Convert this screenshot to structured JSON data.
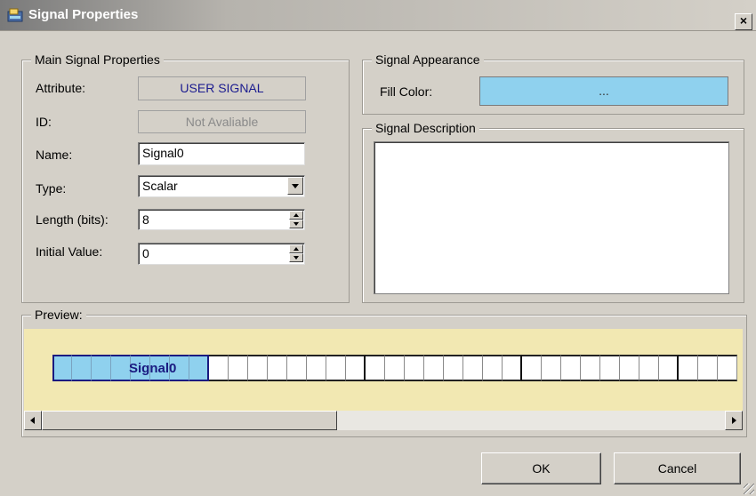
{
  "window": {
    "title": "Signal Properties",
    "icon": "signal-properties-icon",
    "close_label": "×"
  },
  "main_props": {
    "legend": "Main Signal Properties",
    "attribute_label": "Attribute:",
    "attribute_value": "USER SIGNAL",
    "id_label": "ID:",
    "id_value": "Not Avaliable",
    "name_label": "Name:",
    "name_value": "Signal0",
    "type_label": "Type:",
    "type_value": "Scalar",
    "length_label": "Length (bits):",
    "length_value": "8",
    "initial_label": "Initial Value:",
    "initial_value": "0"
  },
  "appearance": {
    "legend": "Signal Appearance",
    "fill_label": "Fill Color:",
    "fill_button_label": "...",
    "fill_color": "#8fd1ee"
  },
  "description": {
    "legend": "Signal Description",
    "value": ""
  },
  "preview": {
    "legend": "Preview:",
    "signal_label": "Signal0",
    "signal_bits": 8,
    "background_color": "#f2e8b2"
  },
  "buttons": {
    "ok": "OK",
    "cancel": "Cancel"
  }
}
